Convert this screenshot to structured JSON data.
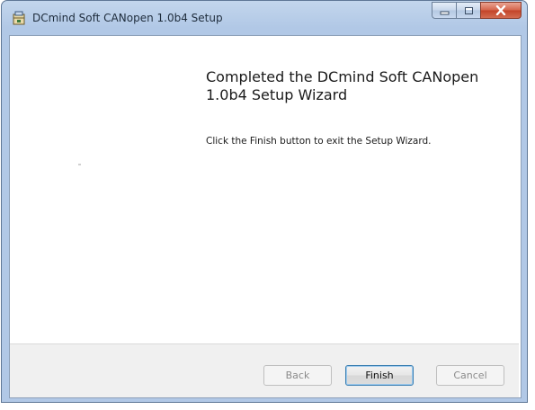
{
  "window": {
    "title": "DCmind Soft CANopen 1.0b4 Setup",
    "icon": "installer-icon",
    "caption_buttons": [
      "minimize-icon",
      "maximize-icon",
      "close-icon"
    ]
  },
  "page": {
    "heading": "Completed the DCmind Soft CANopen 1.0b4 Setup Wizard",
    "description": "Click the Finish button to exit the Setup Wizard."
  },
  "footer": {
    "back_label": "Back",
    "back_enabled": false,
    "finish_label": "Finish",
    "finish_default": true,
    "cancel_label": "Cancel",
    "cancel_enabled": false
  }
}
